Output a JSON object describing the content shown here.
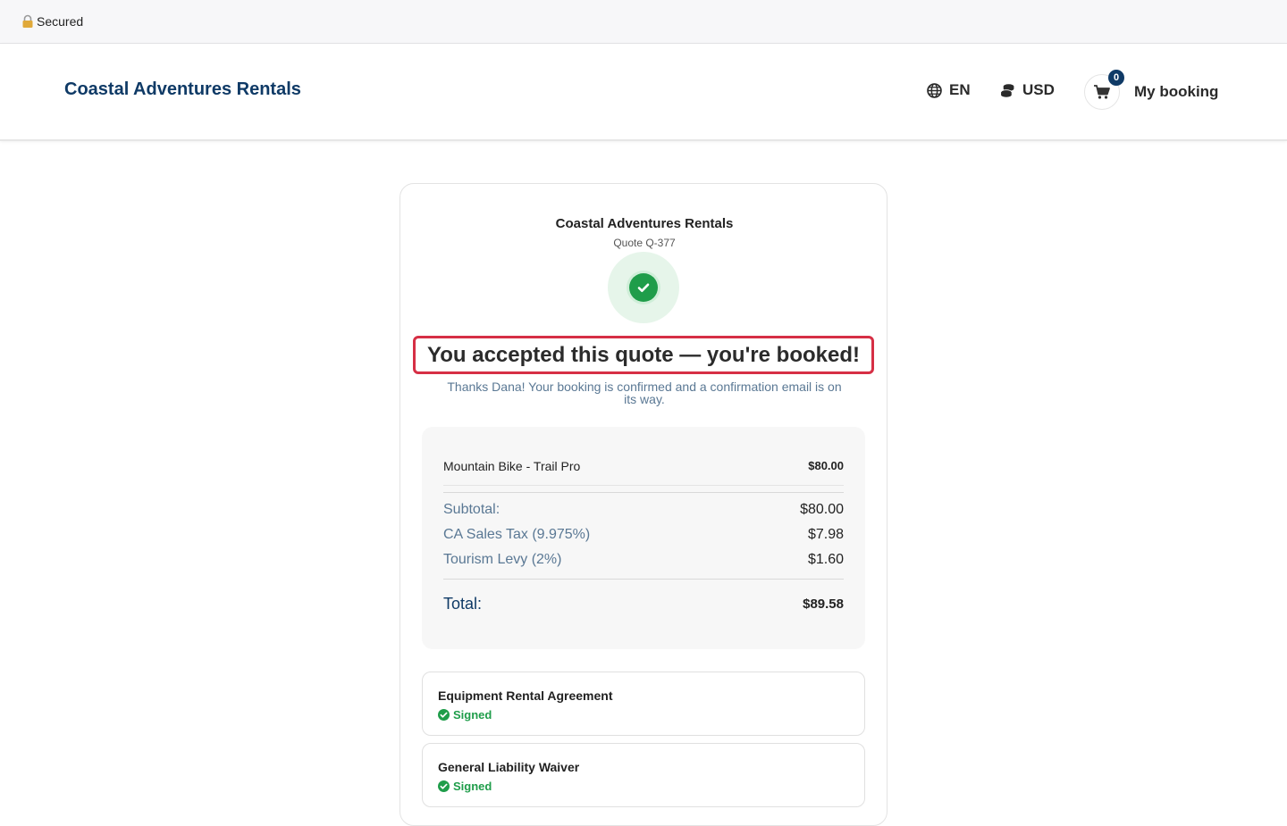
{
  "security": {
    "label": "Secured"
  },
  "header": {
    "brand": "Coastal Adventures Rentals",
    "language": "EN",
    "currency": "USD",
    "cart_count": "0",
    "my_booking": "My booking"
  },
  "quote": {
    "company": "Coastal Adventures Rentals",
    "quote_id": "Quote Q-377",
    "headline": "You accepted this quote — you're booked!",
    "message": "Thanks Dana! Your booking is confirmed and a confirmation email is on its way.",
    "items": [
      {
        "name": "Mountain Bike - Trail Pro",
        "price": "$80.00"
      }
    ],
    "subtotal_label": "Subtotal:",
    "subtotal": "$80.00",
    "fees": [
      {
        "label": "CA Sales Tax (9.975%)",
        "amount": "$7.98"
      },
      {
        "label": "Tourism Levy (2%)",
        "amount": "$1.60"
      }
    ],
    "total_label": "Total:",
    "total": "$89.58"
  },
  "documents": [
    {
      "title": "Equipment Rental Agreement",
      "status": "Signed"
    },
    {
      "title": "General Liability Waiver",
      "status": "Signed"
    }
  ],
  "colors": {
    "brand": "#0f3a66",
    "success": "#1f9d4a",
    "highlight": "#d62f45",
    "muted": "#5a7894"
  }
}
